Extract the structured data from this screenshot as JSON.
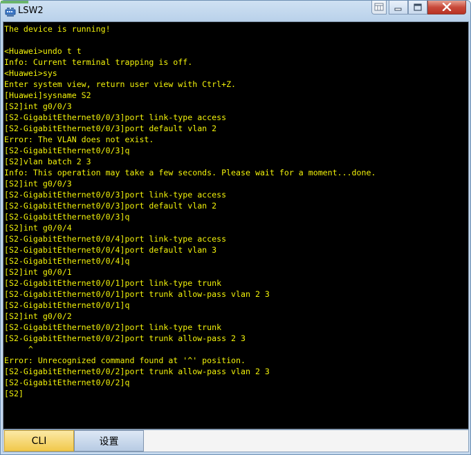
{
  "window": {
    "title": "LSW2",
    "colors": {
      "terminal_bg": "#000000",
      "terminal_text": "#f2f20a",
      "cli_tab": "#f1c84b",
      "close_button": "#c8493a"
    }
  },
  "terminal": {
    "lines": [
      "The device is running!",
      "",
      "<Huawei>undo t t",
      "Info: Current terminal trapping is off.",
      "<Huawei>sys",
      "Enter system view, return user view with Ctrl+Z.",
      "[Huawei]sysname S2",
      "[S2]int g0/0/3",
      "[S2-GigabitEthernet0/0/3]port link-type access",
      "[S2-GigabitEthernet0/0/3]port default vlan 2",
      "Error: The VLAN does not exist.",
      "[S2-GigabitEthernet0/0/3]q",
      "[S2]vlan batch 2 3",
      "Info: This operation may take a few seconds. Please wait for a moment...done.",
      "[S2]int g0/0/3",
      "[S2-GigabitEthernet0/0/3]port link-type access",
      "[S2-GigabitEthernet0/0/3]port default vlan 2",
      "[S2-GigabitEthernet0/0/3]q",
      "[S2]int g0/0/4",
      "[S2-GigabitEthernet0/0/4]port link-type access",
      "[S2-GigabitEthernet0/0/4]port default vlan 3",
      "[S2-GigabitEthernet0/0/4]q",
      "[S2]int g0/0/1",
      "[S2-GigabitEthernet0/0/1]port link-type trunk",
      "[S2-GigabitEthernet0/0/1]port trunk allow-pass vlan 2 3",
      "[S2-GigabitEthernet0/0/1]q",
      "[S2]int g0/0/2",
      "[S2-GigabitEthernet0/0/2]port link-type trunk",
      "[S2-GigabitEthernet0/0/2]port trunk allow-pass 2 3",
      "     ^",
      "Error: Unrecognized command found at '^' position.",
      "[S2-GigabitEthernet0/0/2]port trunk allow-pass vlan 2 3",
      "[S2-GigabitEthernet0/0/2]q",
      "[S2]"
    ]
  },
  "tabs": [
    {
      "label": "CLI",
      "active": true
    },
    {
      "label": "设置",
      "active": false
    }
  ],
  "icons": {
    "app": "switch-icon",
    "restore": "restore-icon",
    "minimize": "minimize-icon",
    "maximize": "maximize-icon",
    "close": "close-icon"
  }
}
